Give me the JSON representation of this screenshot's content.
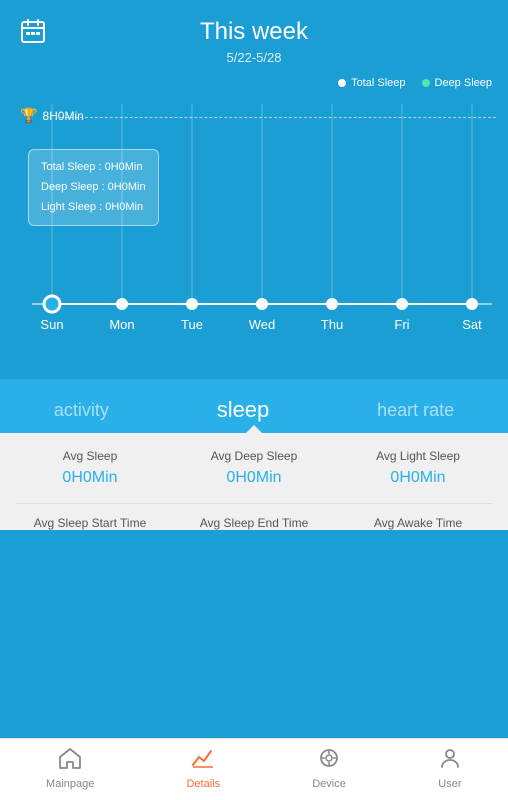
{
  "header": {
    "title": "This week",
    "date_range": "5/22-5/28",
    "calendar_icon": "📅"
  },
  "legend": {
    "items": [
      {
        "label": "Total Sleep",
        "color": "#ffffff"
      },
      {
        "label": "Deep Sleep",
        "color": "#4de8b0"
      }
    ]
  },
  "chart": {
    "y_label": "8H0Min",
    "days": [
      "Sun",
      "Mon",
      "Tue",
      "Wed",
      "Thu",
      "Fri",
      "Sat"
    ],
    "tooltip": {
      "total_sleep": "Total Sleep : 0H0Min",
      "deep_sleep": "Deep Sleep : 0H0Min",
      "light_sleep": "Light Sleep : 0H0Min"
    }
  },
  "tabs": {
    "items": [
      {
        "label": "activity",
        "active": false
      },
      {
        "label": "sleep",
        "active": true
      },
      {
        "label": "heart rate",
        "active": false
      }
    ]
  },
  "stats": {
    "row1": [
      {
        "label": "Avg Sleep",
        "value": "0H0Min"
      },
      {
        "label": "Avg Deep Sleep",
        "value": "0H0Min"
      },
      {
        "label": "Avg Light Sleep",
        "value": "0H0Min"
      }
    ],
    "row2": [
      {
        "label": "Avg Sleep Start Time"
      },
      {
        "label": "Avg Sleep End Time"
      },
      {
        "label": "Avg Awake Time"
      }
    ]
  },
  "bottom_nav": {
    "items": [
      {
        "label": "Mainpage",
        "icon": "⌂",
        "active": false
      },
      {
        "label": "Details",
        "icon": "📈",
        "active": true
      },
      {
        "label": "Device",
        "icon": "◎",
        "active": false
      },
      {
        "label": "User",
        "icon": "👤",
        "active": false
      }
    ]
  }
}
